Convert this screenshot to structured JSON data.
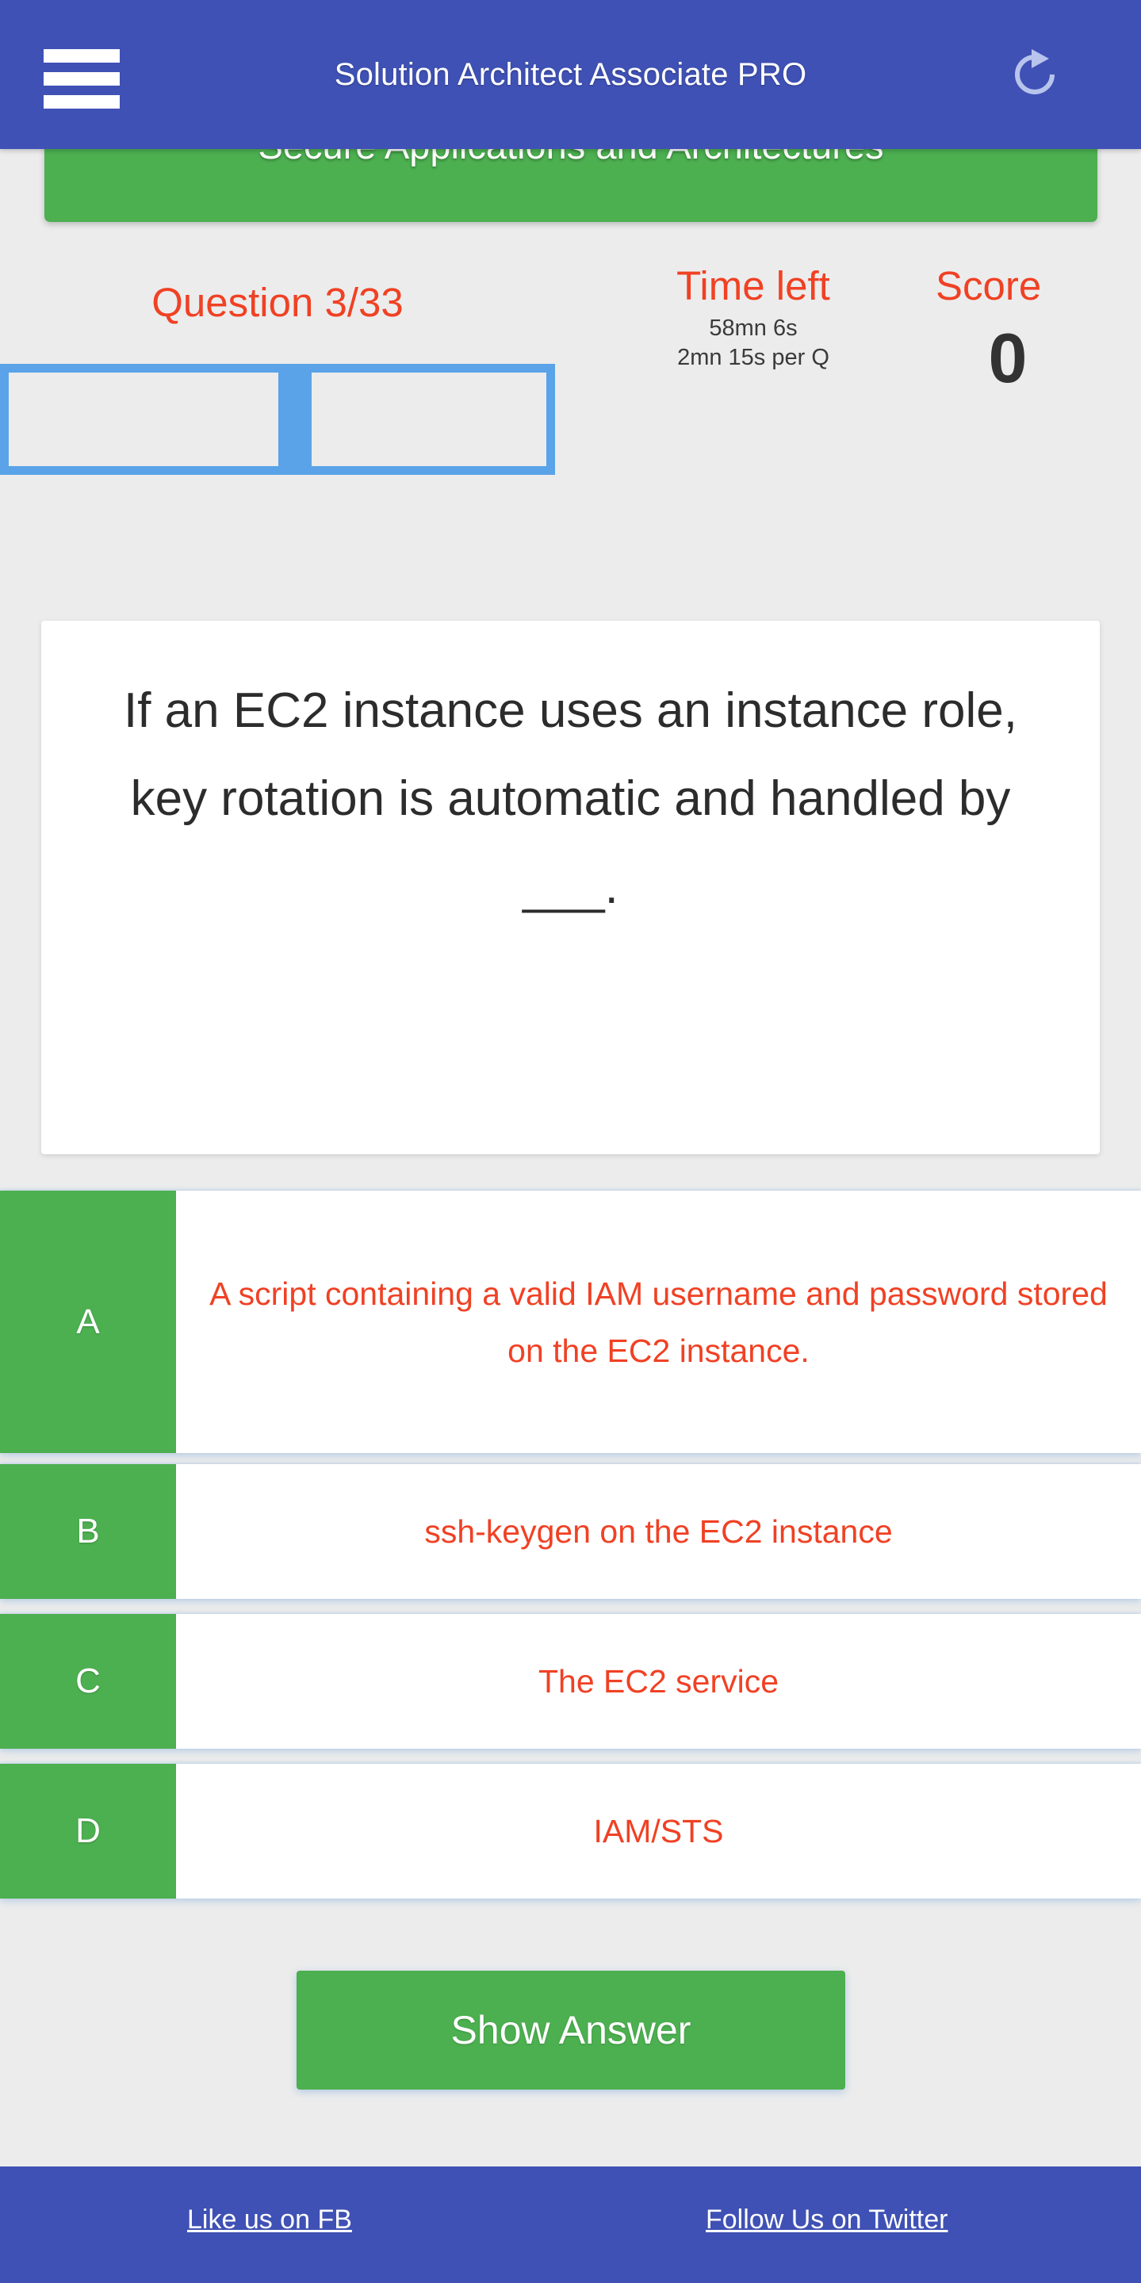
{
  "header": {
    "title": "Solution Architect Associate PRO",
    "menu_icon": "hamburger-menu-icon",
    "refresh_icon": "refresh-icon",
    "background_color": "#3f51b5"
  },
  "topic_banner": {
    "label": "Secure Applications and Architectures",
    "background_color": "#4caf50"
  },
  "stats": {
    "question_counter": "Question 3/33",
    "current_question": 3,
    "total_questions": 33,
    "time_left_label": "Time left",
    "time_remaining": "58mn 6s",
    "time_per_question": "2mn 15s per Q",
    "score_label": "Score",
    "score_value": "0",
    "accent_color": "#f04124",
    "progress_color": "#5aa3e8"
  },
  "question": {
    "text": "If an EC2 instance uses an instance role, key rotation is automatic and handled by ___."
  },
  "answers": [
    {
      "letter": "A",
      "text": "A script containing a valid IAM username and password stored on the EC2 instance."
    },
    {
      "letter": "B",
      "text": "ssh-keygen on the EC2 instance"
    },
    {
      "letter": "C",
      "text": "The EC2 service"
    },
    {
      "letter": "D",
      "text": "IAM/STS"
    }
  ],
  "actions": {
    "show_answer_label": "Show Answer"
  },
  "footer": {
    "facebook_link": "Like us on FB",
    "twitter_link": "Follow Us on Twitter",
    "background_color": "#3f51b5"
  }
}
